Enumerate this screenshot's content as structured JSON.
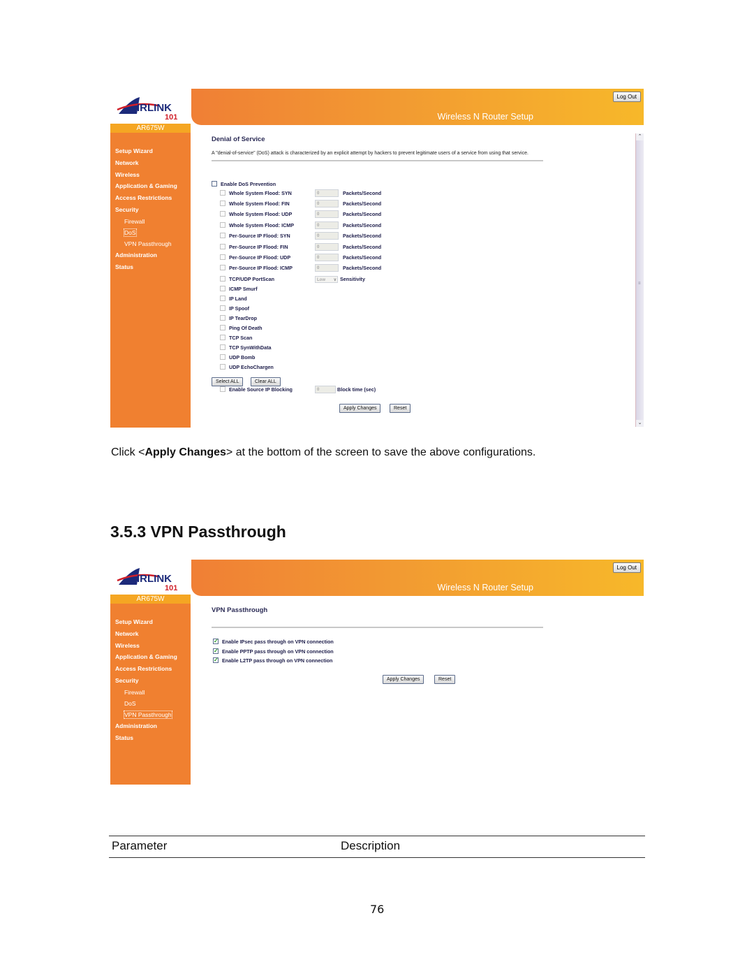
{
  "screens": [
    {
      "logo": {
        "brand": "AIRLINK",
        "brand_sub": "101",
        "model": "AR675W"
      },
      "header": {
        "title": "Wireless N Router Setup",
        "logout_label": "Log Out"
      },
      "nav": {
        "items": [
          "Setup Wizard",
          "Network",
          "Wireless",
          "Application & Gaming",
          "Access Restrictions",
          "Security"
        ],
        "sub_items": [
          "Firewall",
          "DoS",
          "VPN Passthrough"
        ],
        "items_after": [
          "Administration",
          "Status"
        ],
        "selected": "DoS"
      },
      "content": {
        "title": "Denial of Service",
        "description": "A \"denial-of-service\" (DoS) attack is characterized by an explicit attempt by hackers to prevent legitimate users of a service from using that service.",
        "enable_label": "Enable DoS Prevention",
        "enable_checked": false,
        "rate_options": [
          {
            "label": "Whole System Flood: SYN",
            "value": "0",
            "unit": "Packets/Second"
          },
          {
            "label": "Whole System Flood: FIN",
            "value": "0",
            "unit": "Packets/Second"
          },
          {
            "label": "Whole System Flood: UDP",
            "value": "0",
            "unit": "Packets/Second"
          },
          {
            "label": "Whole System Flood: ICMP",
            "value": "0",
            "unit": "Packets/Second"
          },
          {
            "label": "Per-Source IP Flood: SYN",
            "value": "0",
            "unit": "Packets/Second"
          },
          {
            "label": "Per-Source IP Flood: FIN",
            "value": "0",
            "unit": "Packets/Second"
          },
          {
            "label": "Per-Source IP Flood: UDP",
            "value": "0",
            "unit": "Packets/Second"
          },
          {
            "label": "Per-Source IP Flood: ICMP",
            "value": "0",
            "unit": "Packets/Second"
          }
        ],
        "portscan": {
          "label": "TCP/UDP PortScan",
          "select_value": "Low",
          "unit": "Sensitivity"
        },
        "simple_options": [
          "ICMP Smurf",
          "IP Land",
          "IP Spoof",
          "IP TearDrop",
          "Ping Of Death",
          "TCP Scan",
          "TCP SynWithData",
          "UDP Bomb",
          "UDP EchoChargen"
        ],
        "select_all_label": "Select ALL",
        "clear_all_label": "Clear ALL",
        "source_ip_blocking": {
          "label": "Enable Source IP Blocking",
          "value": "0",
          "unit": "Block time (sec)"
        },
        "apply_label": "Apply Changes",
        "reset_label": "Reset"
      }
    },
    {
      "logo": {
        "brand": "AIRLINK",
        "brand_sub": "101",
        "model": "AR675W"
      },
      "header": {
        "title": "Wireless N Router Setup",
        "logout_label": "Log Out"
      },
      "nav": {
        "items": [
          "Setup Wizard",
          "Network",
          "Wireless",
          "Application & Gaming",
          "Access Restrictions",
          "Security"
        ],
        "sub_items": [
          "Firewall",
          "DoS",
          "VPN Passthrough"
        ],
        "items_after": [
          "Administration",
          "Status"
        ],
        "selected": "VPN Passthrough"
      },
      "content": {
        "title": "VPN Passthrough",
        "options": [
          {
            "label": "Enable IPsec pass through on VPN connection",
            "checked": true
          },
          {
            "label": "Enable PPTP pass through on VPN connection",
            "checked": true
          },
          {
            "label": "Enable L2TP pass through on VPN connection",
            "checked": true
          }
        ],
        "apply_label": "Apply Changes",
        "reset_label": "Reset"
      }
    }
  ],
  "doc": {
    "caption_pre": "Click <",
    "caption_bold": "Apply Changes",
    "caption_post": "> at the bottom of the screen to save the above configurations.",
    "section_title": "3.5.3 VPN Passthrough",
    "table_headers": [
      "Parameter",
      "Description"
    ],
    "page_number": "76"
  },
  "colors": {
    "nav_orange": "#f08030",
    "model_bar": "#f5a623",
    "title_navy": "#2b2b55"
  }
}
